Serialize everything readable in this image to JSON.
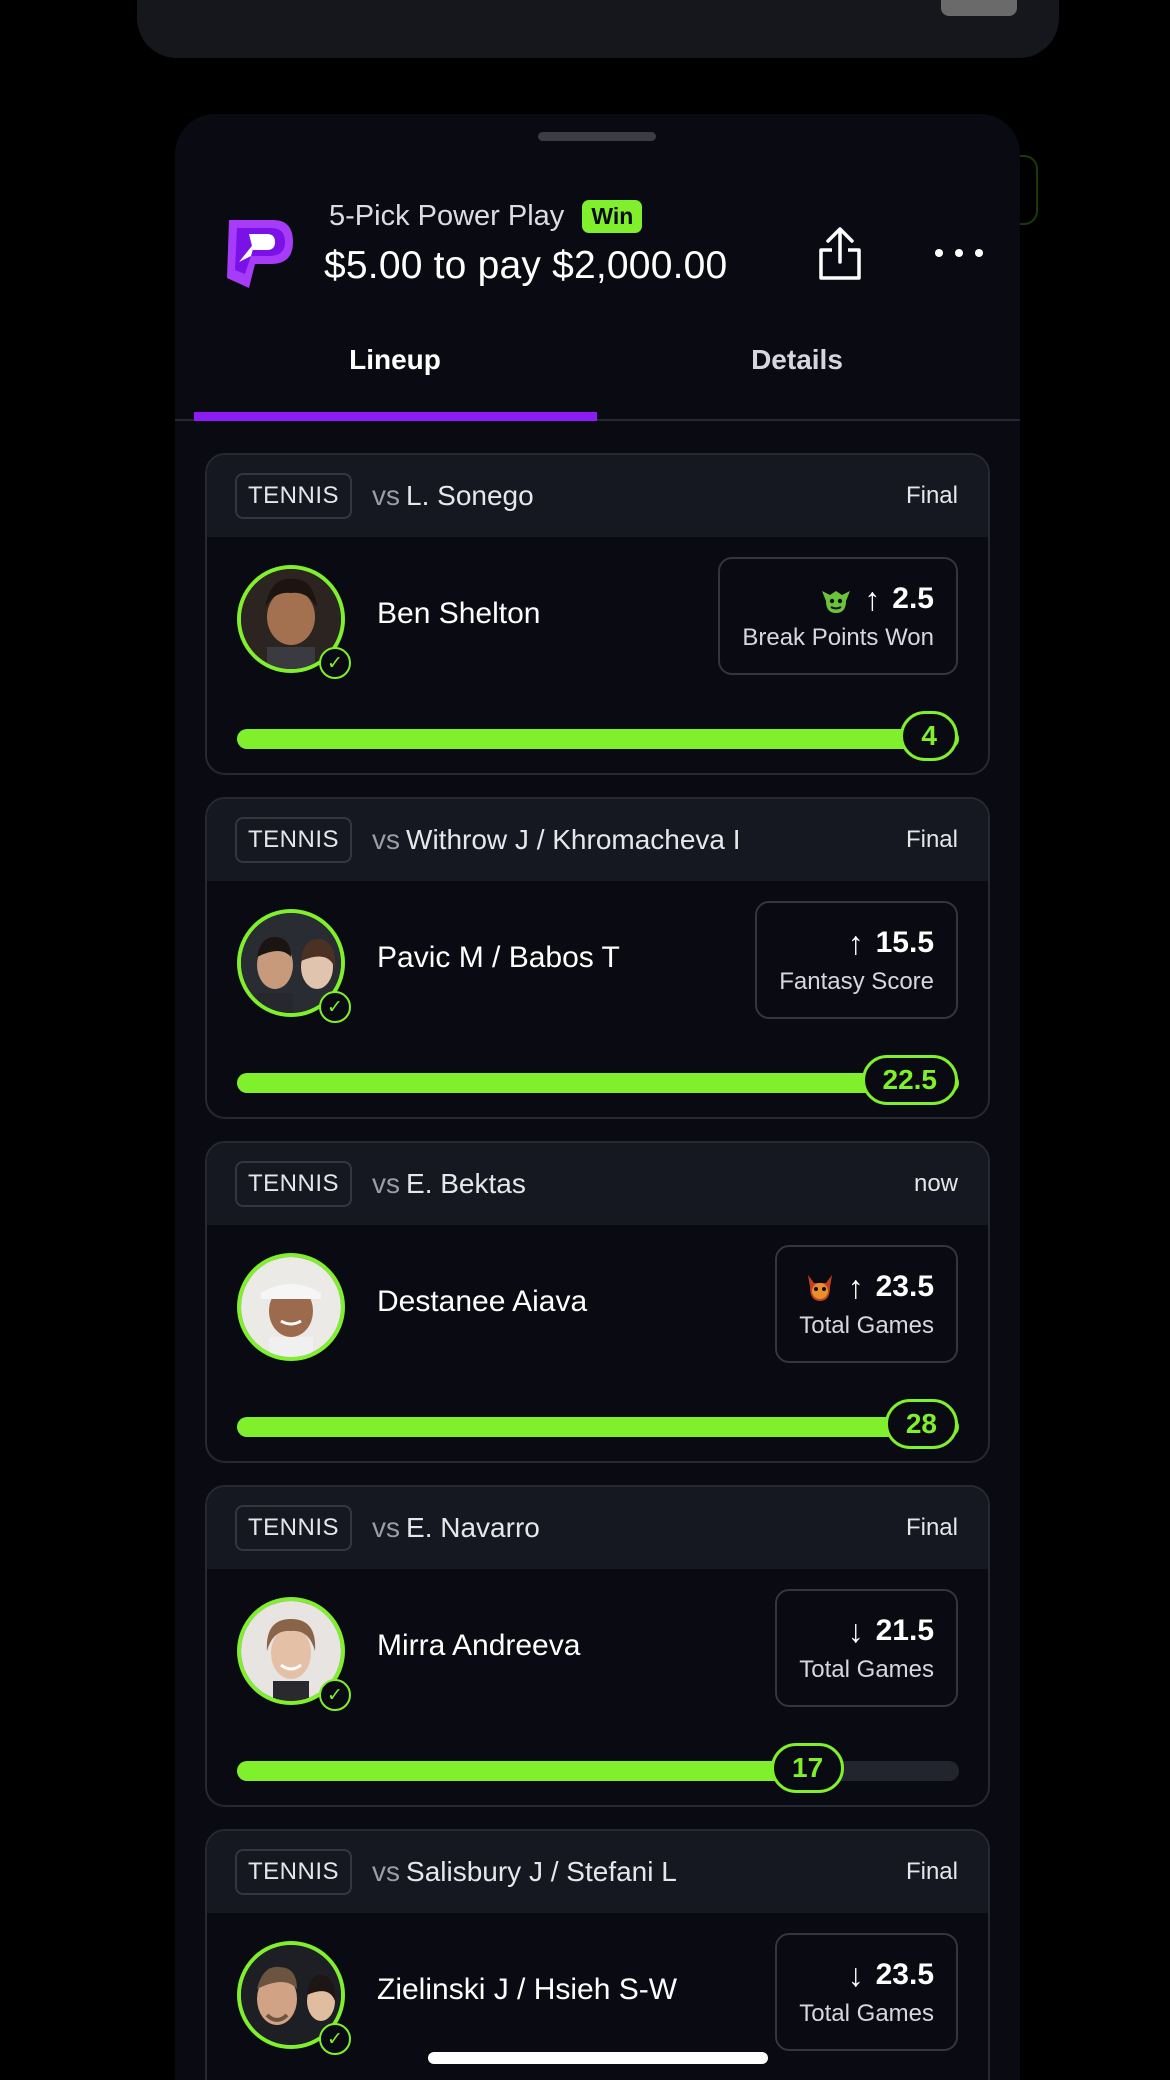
{
  "header": {
    "title": "5-Pick Power Play",
    "badge": "Win",
    "subtitle": "$5.00 to pay $2,000.00",
    "share_icon": "share-icon",
    "more_icon": "more-icon"
  },
  "tabs": [
    {
      "label": "Lineup",
      "active": true
    },
    {
      "label": "Details",
      "active": false
    }
  ],
  "colors": {
    "accent": "#7ff02b",
    "brand": "#8b1cf5",
    "background": "#0a0b12"
  },
  "picks": [
    {
      "sport": "TENNIS",
      "vs": "vs",
      "opponent": "L. Sonego",
      "status": "Final",
      "player": "Ben Shelton",
      "direction": "↑",
      "line": "2.5",
      "stat": "Break Points Won",
      "result": "4",
      "progress": 1.0,
      "check": true,
      "emoji": "goblin-icon"
    },
    {
      "sport": "TENNIS",
      "vs": "vs",
      "opponent": "Withrow J / Khromacheva I",
      "status": "Final",
      "player": "Pavic M / Babos T",
      "direction": "↑",
      "line": "15.5",
      "stat": "Fantasy Score",
      "result": "22.5",
      "progress": 1.0,
      "check": true,
      "emoji": ""
    },
    {
      "sport": "TENNIS",
      "vs": "vs",
      "opponent": "E. Bektas",
      "status": "now",
      "player": "Destanee Aiava",
      "direction": "↑",
      "line": "23.5",
      "stat": "Total Games",
      "result": "28",
      "progress": 1.0,
      "check": false,
      "emoji": "demon-icon"
    },
    {
      "sport": "TENNIS",
      "vs": "vs",
      "opponent": "E. Navarro",
      "status": "Final",
      "player": "Mirra Andreeva",
      "direction": "↓",
      "line": "21.5",
      "stat": "Total Games",
      "result": "17",
      "progress": 0.8,
      "check": true,
      "emoji": ""
    },
    {
      "sport": "TENNIS",
      "vs": "vs",
      "opponent": "Salisbury J / Stefani L",
      "status": "Final",
      "player": "Zielinski J / Hsieh S-W",
      "direction": "↓",
      "line": "23.5",
      "stat": "Total Games",
      "result": "",
      "progress": 1.0,
      "check": true,
      "emoji": ""
    }
  ]
}
